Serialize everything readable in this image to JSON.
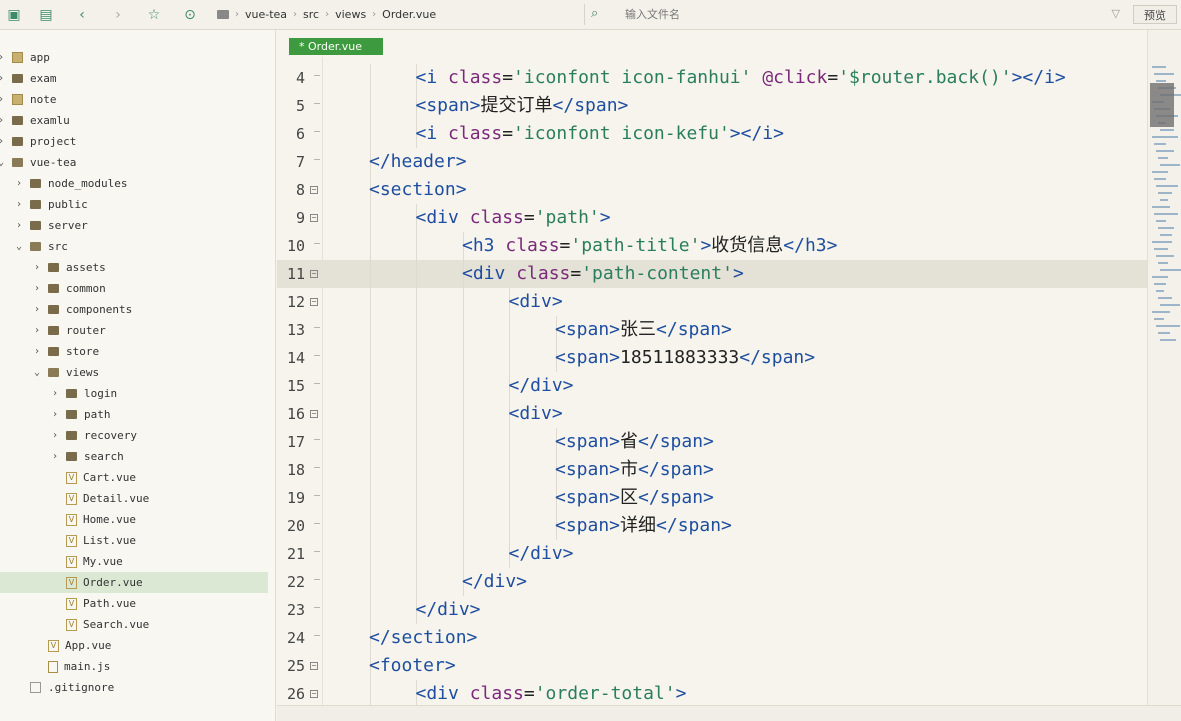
{
  "toolbar": {
    "icons": [
      "new-file-icon",
      "save-icon",
      "back-icon",
      "forward-icon",
      "star-icon",
      "run-icon"
    ],
    "breadcrumb": [
      "vue-tea",
      "src",
      "views",
      "Order.vue"
    ],
    "search_placeholder": "输入文件名",
    "preview_label": "预览"
  },
  "sidebar": {
    "items": [
      {
        "label": "app",
        "type": "project",
        "depth": 0,
        "expanded": false
      },
      {
        "label": "exam",
        "type": "folder",
        "depth": 0,
        "expanded": false
      },
      {
        "label": "note",
        "type": "project",
        "depth": 0,
        "expanded": false
      },
      {
        "label": "examlu",
        "type": "folder",
        "depth": 0,
        "expanded": false
      },
      {
        "label": "project",
        "type": "folder",
        "depth": 0,
        "expanded": false
      },
      {
        "label": "vue-tea",
        "type": "folder",
        "depth": 0,
        "expanded": true
      },
      {
        "label": "node_modules",
        "type": "folder",
        "depth": 1,
        "expanded": false
      },
      {
        "label": "public",
        "type": "folder",
        "depth": 1,
        "expanded": false
      },
      {
        "label": "server",
        "type": "folder",
        "depth": 1,
        "expanded": false
      },
      {
        "label": "src",
        "type": "folder",
        "depth": 1,
        "expanded": true
      },
      {
        "label": "assets",
        "type": "folder",
        "depth": 2,
        "expanded": false
      },
      {
        "label": "common",
        "type": "folder",
        "depth": 2,
        "expanded": false
      },
      {
        "label": "components",
        "type": "folder",
        "depth": 2,
        "expanded": false
      },
      {
        "label": "router",
        "type": "folder",
        "depth": 2,
        "expanded": false
      },
      {
        "label": "store",
        "type": "folder",
        "depth": 2,
        "expanded": false
      },
      {
        "label": "views",
        "type": "folder",
        "depth": 2,
        "expanded": true
      },
      {
        "label": "login",
        "type": "folder",
        "depth": 3,
        "expanded": false
      },
      {
        "label": "path",
        "type": "folder",
        "depth": 3,
        "expanded": false
      },
      {
        "label": "recovery",
        "type": "folder",
        "depth": 3,
        "expanded": false
      },
      {
        "label": "search",
        "type": "folder",
        "depth": 3,
        "expanded": false
      },
      {
        "label": "Cart.vue",
        "type": "vue",
        "depth": 3
      },
      {
        "label": "Detail.vue",
        "type": "vue",
        "depth": 3
      },
      {
        "label": "Home.vue",
        "type": "vue",
        "depth": 3
      },
      {
        "label": "List.vue",
        "type": "vue",
        "depth": 3
      },
      {
        "label": "My.vue",
        "type": "vue",
        "depth": 3
      },
      {
        "label": "Order.vue",
        "type": "vue",
        "depth": 3,
        "selected": true
      },
      {
        "label": "Path.vue",
        "type": "vue",
        "depth": 3
      },
      {
        "label": "Search.vue",
        "type": "vue",
        "depth": 3
      },
      {
        "label": "App.vue",
        "type": "vue",
        "depth": 2
      },
      {
        "label": "main.js",
        "type": "js",
        "depth": 2
      },
      {
        "label": ".gitignore",
        "type": "file",
        "depth": 1
      }
    ]
  },
  "editor": {
    "tab_label": "* Order.vue",
    "current_line": 11,
    "lines": [
      {
        "n": "4",
        "fold": false,
        "indent": 3,
        "tokens": [
          [
            "t",
            "<i "
          ],
          [
            "a",
            "class"
          ],
          [
            "x",
            "="
          ],
          [
            "s",
            "'iconfont icon-fanhui'"
          ],
          [
            "x",
            " "
          ],
          [
            "a",
            "@click"
          ],
          [
            "x",
            "="
          ],
          [
            "s",
            "'$router.back()'"
          ],
          [
            "t",
            "></i>"
          ]
        ]
      },
      {
        "n": "5",
        "fold": false,
        "indent": 3,
        "tokens": [
          [
            "t",
            "<span>"
          ],
          [
            "x",
            "提交订单"
          ],
          [
            "t",
            "</span>"
          ]
        ]
      },
      {
        "n": "6",
        "fold": false,
        "indent": 3,
        "tokens": [
          [
            "t",
            "<i "
          ],
          [
            "a",
            "class"
          ],
          [
            "x",
            "="
          ],
          [
            "s",
            "'iconfont icon-kefu'"
          ],
          [
            "t",
            "></i>"
          ]
        ]
      },
      {
        "n": "7",
        "fold": false,
        "indent": 2,
        "tokens": [
          [
            "t",
            "</header>"
          ]
        ]
      },
      {
        "n": "8",
        "fold": true,
        "indent": 2,
        "tokens": [
          [
            "t",
            "<section>"
          ]
        ]
      },
      {
        "n": "9",
        "fold": true,
        "indent": 3,
        "tokens": [
          [
            "t",
            "<div "
          ],
          [
            "a",
            "class"
          ],
          [
            "x",
            "="
          ],
          [
            "s",
            "'path'"
          ],
          [
            "t",
            ">"
          ]
        ]
      },
      {
        "n": "10",
        "fold": false,
        "indent": 4,
        "tokens": [
          [
            "t",
            "<h3 "
          ],
          [
            "a",
            "class"
          ],
          [
            "x",
            "="
          ],
          [
            "s",
            "'path-title'"
          ],
          [
            "t",
            ">"
          ],
          [
            "x",
            "收货信息"
          ],
          [
            "t",
            "</h3>"
          ]
        ]
      },
      {
        "n": "11",
        "fold": true,
        "indent": 4,
        "tokens": [
          [
            "t",
            "<div "
          ],
          [
            "a",
            "class"
          ],
          [
            "x",
            "="
          ],
          [
            "s",
            "'path-content'"
          ],
          [
            "t",
            ">"
          ]
        ]
      },
      {
        "n": "12",
        "fold": true,
        "indent": 5,
        "tokens": [
          [
            "t",
            "<div>"
          ]
        ]
      },
      {
        "n": "13",
        "fold": false,
        "indent": 6,
        "tokens": [
          [
            "t",
            "<span>"
          ],
          [
            "x",
            "张三"
          ],
          [
            "t",
            "</span>"
          ]
        ]
      },
      {
        "n": "14",
        "fold": false,
        "indent": 6,
        "tokens": [
          [
            "t",
            "<span>"
          ],
          [
            "x",
            "18511883333"
          ],
          [
            "t",
            "</span>"
          ]
        ]
      },
      {
        "n": "15",
        "fold": false,
        "indent": 5,
        "tokens": [
          [
            "t",
            "</div>"
          ]
        ]
      },
      {
        "n": "16",
        "fold": true,
        "indent": 5,
        "tokens": [
          [
            "t",
            "<div>"
          ]
        ]
      },
      {
        "n": "17",
        "fold": false,
        "indent": 6,
        "tokens": [
          [
            "t",
            "<span>"
          ],
          [
            "x",
            "省"
          ],
          [
            "t",
            "</span>"
          ]
        ]
      },
      {
        "n": "18",
        "fold": false,
        "indent": 6,
        "tokens": [
          [
            "t",
            "<span>"
          ],
          [
            "x",
            "市"
          ],
          [
            "t",
            "</span>"
          ]
        ]
      },
      {
        "n": "19",
        "fold": false,
        "indent": 6,
        "tokens": [
          [
            "t",
            "<span>"
          ],
          [
            "x",
            "区"
          ],
          [
            "t",
            "</span>"
          ]
        ]
      },
      {
        "n": "20",
        "fold": false,
        "indent": 6,
        "tokens": [
          [
            "t",
            "<span>"
          ],
          [
            "x",
            "详细"
          ],
          [
            "t",
            "</span>"
          ]
        ]
      },
      {
        "n": "21",
        "fold": false,
        "indent": 5,
        "tokens": [
          [
            "t",
            "</div>"
          ]
        ]
      },
      {
        "n": "22",
        "fold": false,
        "indent": 4,
        "tokens": [
          [
            "t",
            "</div>"
          ]
        ]
      },
      {
        "n": "23",
        "fold": false,
        "indent": 3,
        "tokens": [
          [
            "t",
            "</div>"
          ]
        ]
      },
      {
        "n": "24",
        "fold": false,
        "indent": 2,
        "tokens": [
          [
            "t",
            "</section>"
          ]
        ]
      },
      {
        "n": "25",
        "fold": true,
        "indent": 2,
        "tokens": [
          [
            "t",
            "<footer>"
          ]
        ]
      },
      {
        "n": "26",
        "fold": true,
        "indent": 3,
        "tokens": [
          [
            "t",
            "<div "
          ],
          [
            "a",
            "class"
          ],
          [
            "x",
            "="
          ],
          [
            "s",
            "'order-total'"
          ],
          [
            "t",
            ">"
          ]
        ]
      }
    ]
  },
  "colors": {
    "accent": "#3e9a3e",
    "tag": "#1f4ea0",
    "attr": "#7b2a7b",
    "string": "#2a7e5e"
  }
}
